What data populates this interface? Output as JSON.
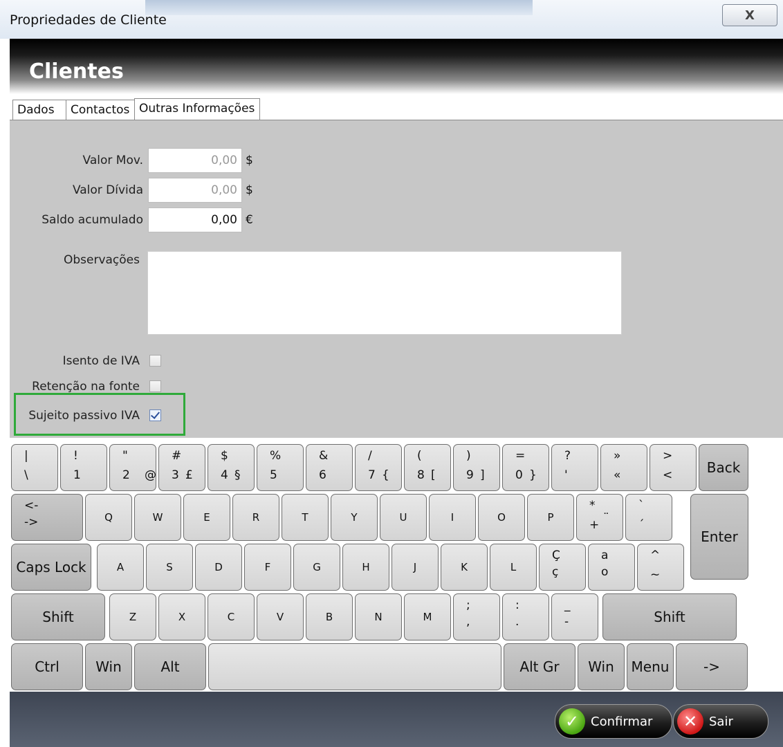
{
  "window": {
    "title": "Propriedades de Cliente",
    "close_icon": "X"
  },
  "header": {
    "title": "Clientes"
  },
  "tabs": [
    {
      "label": "Dados"
    },
    {
      "label": "Contactos"
    },
    {
      "label": "Outras Informações",
      "active": true
    }
  ],
  "form": {
    "valor_mov": {
      "label": "Valor Mov.",
      "value": "0,00",
      "unit": "$"
    },
    "valor_divida": {
      "label": "Valor Dívida",
      "value": "0,00",
      "unit": "$"
    },
    "saldo": {
      "label": "Saldo acumulado",
      "value": "0,00",
      "unit": "€"
    },
    "observacoes": {
      "label": "Observações",
      "value": ""
    },
    "isento_iva": {
      "label": "Isento de IVA",
      "checked": false
    },
    "retencao": {
      "label": "Retenção na fonte",
      "checked": false
    },
    "sujeito_passivo": {
      "label": "Sujeito passivo IVA",
      "checked": true
    }
  },
  "keyboard": {
    "row1": [
      {
        "top": "|",
        "bottom": "\\"
      },
      {
        "top": "!",
        "bottom": "1"
      },
      {
        "top": "\"",
        "bottom": "2",
        "alt": "@"
      },
      {
        "top": "#",
        "bottom": "3",
        "alt": "£"
      },
      {
        "top": "$",
        "bottom": "4",
        "alt": "§"
      },
      {
        "top": "%",
        "bottom": "5"
      },
      {
        "top": "&",
        "bottom": "6"
      },
      {
        "top": "/",
        "bottom": "7",
        "alt": "{"
      },
      {
        "top": "(",
        "bottom": "8",
        "alt": "["
      },
      {
        "top": ")",
        "bottom": "9",
        "alt": "]"
      },
      {
        "top": "=",
        "bottom": "0",
        "alt": "}"
      },
      {
        "top": "?",
        "bottom": "'"
      },
      {
        "top": "»",
        "bottom": "«"
      },
      {
        "top": ">",
        "bottom": "<"
      },
      {
        "label": "Back"
      }
    ],
    "row2": [
      {
        "top": "<-",
        "bottom": "->"
      },
      {
        "label": "Q"
      },
      {
        "label": "W"
      },
      {
        "label": "E"
      },
      {
        "label": "R"
      },
      {
        "label": "T"
      },
      {
        "label": "Y"
      },
      {
        "label": "U"
      },
      {
        "label": "I"
      },
      {
        "label": "O"
      },
      {
        "label": "P"
      },
      {
        "top": "*",
        "bottom": "+",
        "alt": "¨"
      },
      {
        "top": "`",
        "bottom": "´"
      },
      {
        "label": "Enter"
      }
    ],
    "row3": [
      {
        "label": "Caps Lock"
      },
      {
        "label": "A"
      },
      {
        "label": "S"
      },
      {
        "label": "D"
      },
      {
        "label": "F"
      },
      {
        "label": "G"
      },
      {
        "label": "H"
      },
      {
        "label": "J"
      },
      {
        "label": "K"
      },
      {
        "label": "L"
      },
      {
        "top": "Ç",
        "bottom": "ç"
      },
      {
        "top": "a",
        "bottom": "o"
      },
      {
        "top": "^",
        "bottom": "~"
      }
    ],
    "row4": [
      {
        "label": "Shift"
      },
      {
        "label": "Z"
      },
      {
        "label": "X"
      },
      {
        "label": "C"
      },
      {
        "label": "V"
      },
      {
        "label": "B"
      },
      {
        "label": "N"
      },
      {
        "label": "M"
      },
      {
        "top": ";",
        "bottom": ","
      },
      {
        "top": ":",
        "bottom": "."
      },
      {
        "top": "_",
        "bottom": "-"
      },
      {
        "label": "Shift"
      }
    ],
    "row5": [
      {
        "label": "Ctrl"
      },
      {
        "label": "Win"
      },
      {
        "label": "Alt"
      },
      {
        "label": ""
      },
      {
        "label": "Alt Gr"
      },
      {
        "label": "Win"
      },
      {
        "label": "Menu"
      },
      {
        "label": "->"
      }
    ]
  },
  "footer": {
    "confirm_label": "Confirmar",
    "exit_label": "Sair",
    "confirm_icon": "check-icon",
    "exit_icon": "x-icon"
  }
}
